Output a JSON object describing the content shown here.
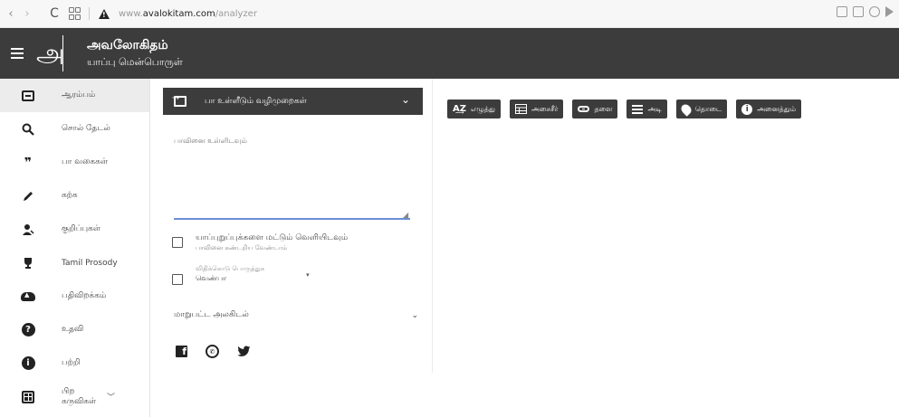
{
  "browser": {
    "url_prefix": "www.",
    "url_host": "avalokitam.com",
    "url_path": "/analyzer"
  },
  "app": {
    "logo_glyph": "அ",
    "title": "அவலோகிதம்",
    "subtitle": "யாப்பு மென்பொருள்"
  },
  "sidebar": {
    "items": [
      {
        "label": "ஆரம்பம்",
        "icon": "square-icon"
      },
      {
        "label": "சொல் தேடல்",
        "icon": "search-icon"
      },
      {
        "label": "பா வகைகள்",
        "icon": "quote-icon"
      },
      {
        "label": "கற்க",
        "icon": "pencil-icon"
      },
      {
        "label": "குறிப்புகள்",
        "icon": "person-icon"
      },
      {
        "label": "Tamil Prosody",
        "icon": "trophy-icon"
      },
      {
        "label": "பதிவிறக்கம்",
        "icon": "cloud-upload-icon"
      },
      {
        "label": "உதவி",
        "icon": "help-icon"
      },
      {
        "label": "பற்றி",
        "icon": "info-icon"
      },
      {
        "label": "பிற கருவிகள்",
        "icon": "grid-icon"
      }
    ]
  },
  "input_panel": {
    "mode_label": "பா உள்ளீடும் வழிமுறைகள்",
    "textarea_placeholder": "பாவினை உள்ளிடவும்",
    "checkbox1_label": "யாப்புறுப்புக்களை மட்டும் வெளியிடவும்",
    "checkbox1_sub": "பாவினை கண்டறிய வேண்டாம்",
    "meter_placeholder": "விதிக்கொடு பொருத்துக",
    "meter_value": "வெண்பா",
    "alankara_label": "மாறுபட்ட அலகிடல்"
  },
  "toolbar": {
    "buttons": [
      {
        "label": "எழுத்து",
        "icon": "az-icon"
      },
      {
        "label": "அசைசீர்",
        "icon": "table-icon"
      },
      {
        "label": "தளை",
        "icon": "link-icon"
      },
      {
        "label": "அடி",
        "icon": "lines-icon"
      },
      {
        "label": "தொடை",
        "icon": "pin-icon"
      },
      {
        "label": "அனைத்தும்",
        "icon": "info-icon"
      }
    ]
  },
  "colors": {
    "header_bg": "#3c3c3c",
    "active_bg": "#ececec",
    "textarea_underline": "#6b8dd6"
  }
}
